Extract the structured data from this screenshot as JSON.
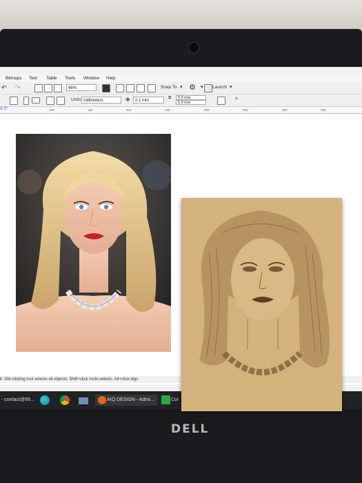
{
  "menu": [
    "Bitmaps",
    "Text",
    "Table",
    "Tools",
    "Window",
    "Help"
  ],
  "toolbar1": {
    "zoom": "66%",
    "snap": "Snap To",
    "launch": "Launch"
  },
  "toolbar2": {
    "units_label": "Units:",
    "units_value": "millimeters",
    "nudge": "0.1 mm",
    "dup_x": "5.0 mm",
    "dup_y": "5.0 mm"
  },
  "ruler_ticks": [
    "100",
    "150",
    "200",
    "250",
    "300",
    "350",
    "400",
    "450"
  ],
  "doc_tab": "d-2*",
  "status_text": "k: Dbl-clicking tool selects all objects; Shift+click multi-selects; Alt+click digs",
  "taskbar": {
    "contact": "- contact@99...",
    "aiq": "AIQ DESIGN - Admi...",
    "cor": "Cor"
  },
  "laptop_brand": "DELL"
}
